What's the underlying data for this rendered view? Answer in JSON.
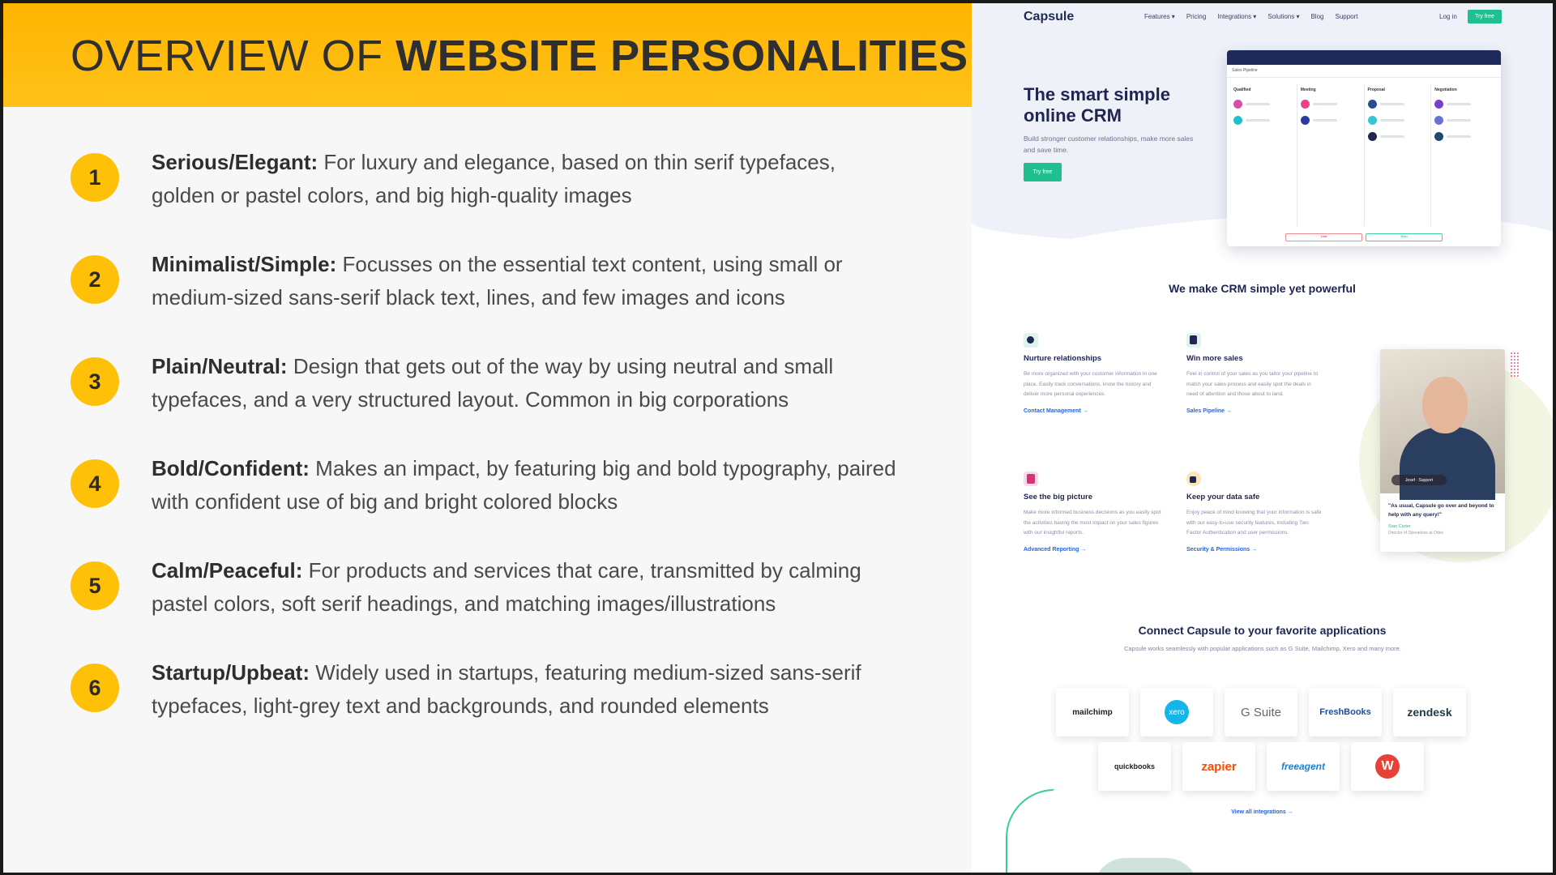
{
  "slide": {
    "title_light": "OVERVIEW OF ",
    "title_bold": "WEBSITE PERSONALITIES",
    "items": [
      {
        "num": "1",
        "label": "Serious/Elegant:",
        "text": " For luxury and elegance, based on thin serif typefaces, golden or pastel colors, and big high-quality images"
      },
      {
        "num": "2",
        "label": "Minimalist/Simple:",
        "text": " Focusses on the essential text content, using small or medium-sized sans-serif black text, lines, and few images and icons"
      },
      {
        "num": "3",
        "label": "Plain/Neutral:",
        "text": " Design that gets out of the way by using neutral and small typefaces, and a very structured layout. Common in big corporations"
      },
      {
        "num": "4",
        "label": "Bold/Confident:",
        "text": " Makes an impact, by featuring big and bold typography, paired with confident use of big and bright colored blocks"
      },
      {
        "num": "5",
        "label": "Calm/Peaceful:",
        "text": " For products and services that care, transmitted by calming pastel colors, soft serif headings, and matching images/illustrations"
      },
      {
        "num": "6",
        "label": "Startup/Upbeat:",
        "text": " Widely used in startups, featuring medium-sized sans-serif typefaces, light-grey text and backgrounds, and rounded elements"
      }
    ]
  },
  "site": {
    "logo": "Capsule",
    "nav": [
      "Features ▾",
      "Pricing",
      "Integrations ▾",
      "Solutions ▾",
      "Blog",
      "Support"
    ],
    "login": "Log in",
    "try_free": "Try free",
    "hero_title": "The smart simple online CRM",
    "hero_sub": "Build stronger customer relationships, make more sales and save time.",
    "hero_cta": "Try free",
    "mock_columns": [
      "Qualified",
      "Meeting",
      "Proposal",
      "Negotiation"
    ],
    "mock_subtitle": "Sales Pipeline",
    "mock_btn_lost": "Lost",
    "mock_btn_won": "Won",
    "section1_title": "We make CRM simple yet powerful",
    "features": [
      {
        "title": "Nurture relationships",
        "desc": "Be more organized with your customer information in one place. Easily track conversations, know the history and deliver more personal experiences.",
        "link": "Contact Management →"
      },
      {
        "title": "Win more sales",
        "desc": "Feel in control of your sales as you tailor your pipeline to match your sales process and easily spot the deals in need of attention and those about to land.",
        "link": "Sales Pipeline →"
      },
      {
        "title": "See the big picture",
        "desc": "Make more informed business decisions as you easily spot the activities having the most impact on your sales figures with our insightful reports.",
        "link": "Advanced Reporting →"
      },
      {
        "title": "Keep your data safe",
        "desc": "Enjoy peace of mind knowing that your information is safe with our easy-to-use security features, including Two Factor Authentication and user permissions.",
        "link": "Security & Permissions →"
      }
    ],
    "testimonial": {
      "tag": "Josef · Support",
      "quote": "\"As usual, Capsule go over and beyond to help with any query!\"",
      "name": "Sian Carter",
      "role": "Director of Operations at Orbio"
    },
    "section2_title": "Connect Capsule to your favorite applications",
    "section2_sub": "Capsule works seamlessly with popular applications such as G Suite, Mailchimp, Xero and many more.",
    "integrations_row1": [
      "mailchimp",
      "xero",
      "G Suite",
      "FreshBooks",
      "zendesk"
    ],
    "integrations_row2": [
      "quickbooks",
      "zapier",
      "freeagent",
      "W"
    ],
    "view_all": "View all integrations →",
    "colors": {
      "accent": "#1fbf8f",
      "navy": "#1e2550",
      "link": "#2565d8",
      "slide_yellow": "#ffc107"
    }
  }
}
